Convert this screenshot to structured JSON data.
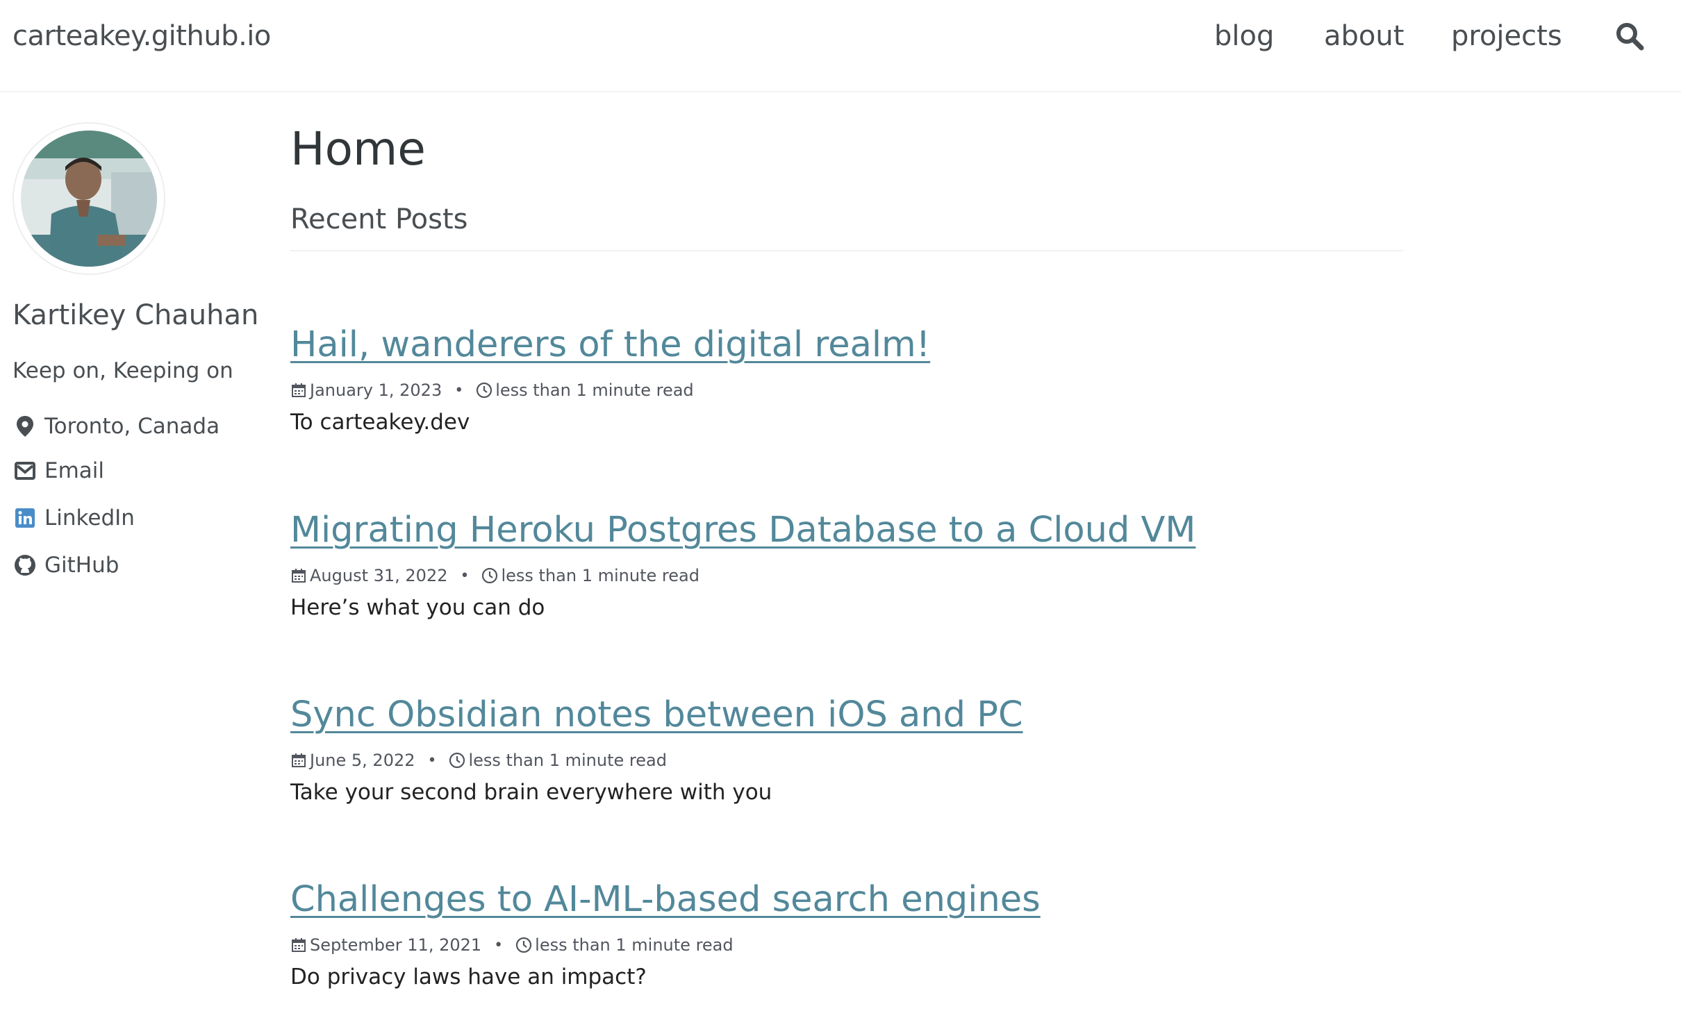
{
  "site": {
    "title": "carteakey.github.io"
  },
  "nav": {
    "items": [
      {
        "label": "blog"
      },
      {
        "label": "about"
      },
      {
        "label": "projects"
      }
    ],
    "search_icon": "search-icon"
  },
  "author": {
    "name": "Kartikey Chauhan",
    "bio": "Keep on, Keeping on",
    "links": [
      {
        "icon": "location-icon",
        "label": "Toronto, Canada"
      },
      {
        "icon": "envelope-icon",
        "label": "Email"
      },
      {
        "icon": "linkedin-icon",
        "label": "LinkedIn"
      },
      {
        "icon": "github-icon",
        "label": "GitHub"
      }
    ]
  },
  "page": {
    "title": "Home",
    "section_title": "Recent Posts"
  },
  "posts": [
    {
      "title": "Hail, wanderers of the digital realm!",
      "date": "January 1, 2023",
      "read_time": "less than 1 minute read",
      "excerpt": "To carteakey.dev"
    },
    {
      "title": "Migrating Heroku Postgres Database to a Cloud VM",
      "date": "August 31, 2022",
      "read_time": "less than 1 minute read",
      "excerpt": "Here’s what you can do"
    },
    {
      "title": "Sync Obsidian notes between iOS and PC",
      "date": "June 5, 2022",
      "read_time": "less than 1 minute read",
      "excerpt": "Take your second brain everywhere with you"
    },
    {
      "title": "Challenges to AI-ML-based search engines",
      "date": "September 11, 2021",
      "read_time": "less than 1 minute read",
      "excerpt": "Do privacy laws have an impact?"
    }
  ],
  "colors": {
    "link": "#52889a",
    "text": "#494e52",
    "heading": "#313639"
  }
}
